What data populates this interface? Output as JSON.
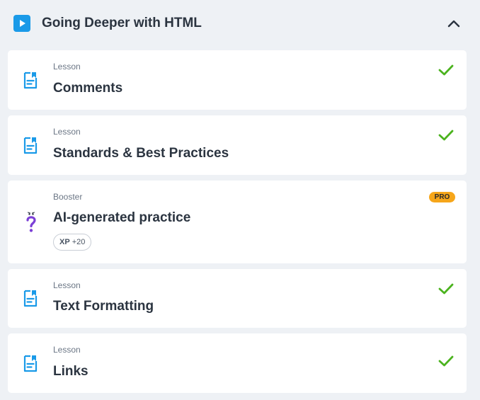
{
  "section": {
    "title": "Going Deeper with HTML"
  },
  "items": [
    {
      "type": "Lesson",
      "title": "Comments",
      "completed": true,
      "icon": "lesson-doc-icon"
    },
    {
      "type": "Lesson",
      "title": "Standards & Best Practices",
      "completed": true,
      "icon": "lesson-doc-icon"
    },
    {
      "type": "Booster",
      "title": "AI-generated practice",
      "badge": "PRO",
      "xp_label": "XP",
      "xp_value": "+20",
      "icon": "question-mark-icon"
    },
    {
      "type": "Lesson",
      "title": "Text Formatting",
      "completed": true,
      "icon": "lesson-doc-icon"
    },
    {
      "type": "Lesson",
      "title": "Links",
      "completed": true,
      "icon": "lesson-doc-icon"
    }
  ],
  "colors": {
    "accent": "#1a9ae8",
    "check": "#4bb31e",
    "pro_badge": "#f6a61a",
    "booster_icon": "#7b3fd6"
  }
}
